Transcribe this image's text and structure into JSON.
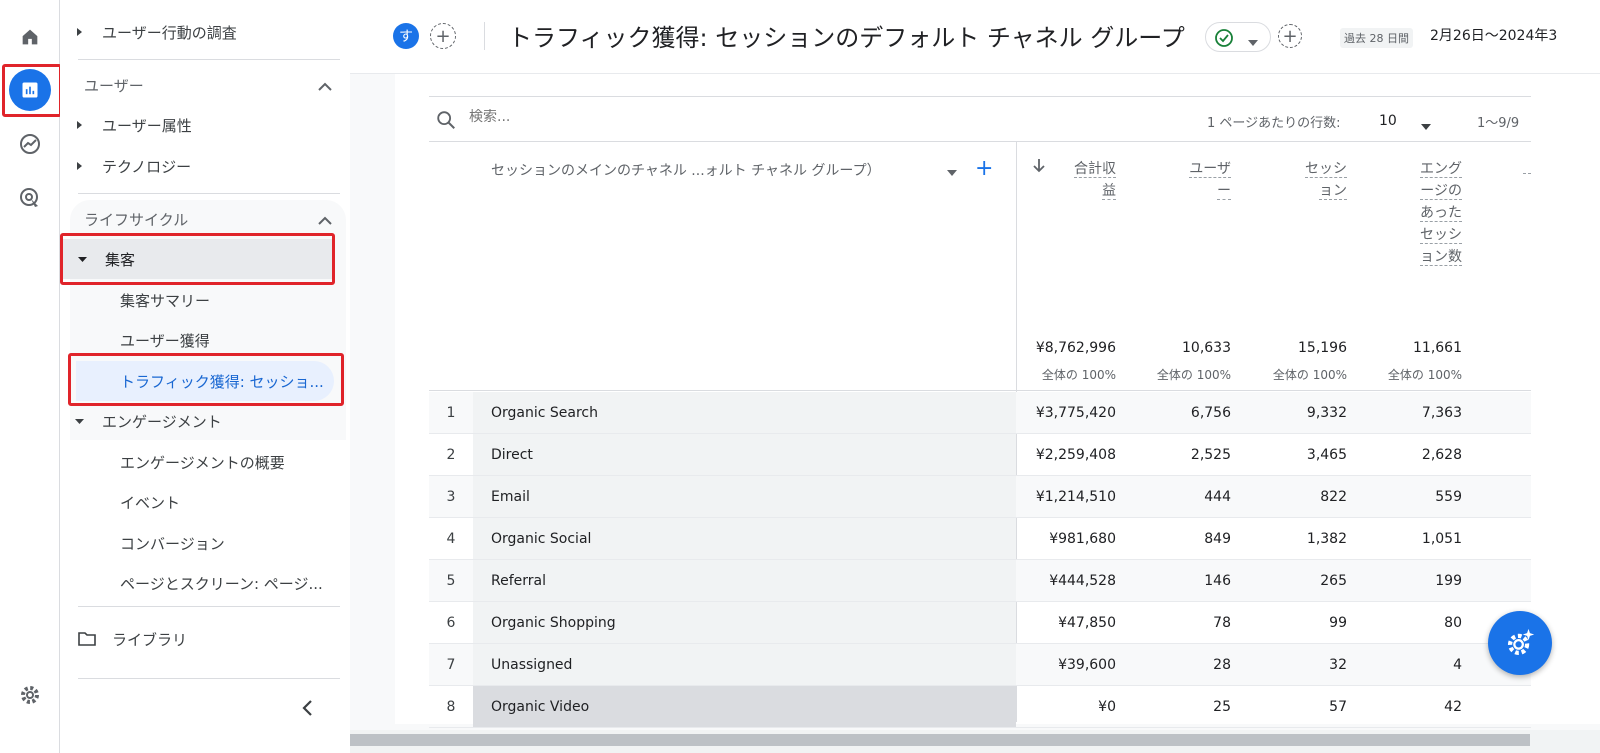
{
  "header": {
    "avatar_letter": "す",
    "title": "トラフィック獲得: セッションのデフォルト チャネル グループ",
    "date_prefix": "過去 28 日間",
    "date_range": "2月26日～2024年3"
  },
  "rail": {
    "items": [
      {
        "icon": "home-icon"
      },
      {
        "icon": "reports-icon",
        "active": true
      },
      {
        "icon": "explore-icon"
      },
      {
        "icon": "advertising-icon"
      },
      {
        "icon": "settings-icon"
      }
    ]
  },
  "nav": {
    "behavior_label": "ユーザー行動の調査",
    "user_section": "ユーザー",
    "user_attributes": "ユーザー属性",
    "technology": "テクノロジー",
    "lifecycle_section": "ライフサイクル",
    "acquisition": "集客",
    "acquisition_overview": "集客サマリー",
    "user_acquisition": "ユーザー獲得",
    "traffic_acquisition": "トラフィック獲得: セッショ...",
    "engagement": "エンゲージメント",
    "engagement_overview": "エンゲージメントの概要",
    "events": "イベント",
    "conversions": "コンバージョン",
    "pages_screens": "ページとスクリーン: ページ...",
    "library": "ライブラリ"
  },
  "toolbar": {
    "search_placeholder": "検索...",
    "rows_per_page_label": "1 ページあたりの行数:",
    "rows_per_page_value": "10",
    "pager_text": "1～9/9"
  },
  "table": {
    "dimension_header": "セッションのメインのチャネル ...ォルト チャネル グループ）",
    "metric_headers": [
      [
        "合計収",
        "益"
      ],
      [
        "ユーザ",
        "ー"
      ],
      [
        "セッシ",
        "ョン"
      ],
      [
        "エング",
        "ージの",
        "あった",
        "セッシ",
        "ョン数"
      ]
    ],
    "totals": [
      "¥8,762,996",
      "10,633",
      "15,196",
      "11,661"
    ],
    "totals_sub": [
      "全体の 100%",
      "全体の 100%",
      "全体の 100%",
      "全体の 100%"
    ],
    "rows": [
      {
        "idx": "1",
        "channel": "Organic Search",
        "revenue": "¥3,775,420",
        "users": "6,756",
        "sessions": "9,332",
        "engaged": "7,363"
      },
      {
        "idx": "2",
        "channel": "Direct",
        "revenue": "¥2,259,408",
        "users": "2,525",
        "sessions": "3,465",
        "engaged": "2,628"
      },
      {
        "idx": "3",
        "channel": "Email",
        "revenue": "¥1,214,510",
        "users": "444",
        "sessions": "822",
        "engaged": "559"
      },
      {
        "idx": "4",
        "channel": "Organic Social",
        "revenue": "¥981,680",
        "users": "849",
        "sessions": "1,382",
        "engaged": "1,051"
      },
      {
        "idx": "5",
        "channel": "Referral",
        "revenue": "¥444,528",
        "users": "146",
        "sessions": "265",
        "engaged": "199"
      },
      {
        "idx": "6",
        "channel": "Organic Shopping",
        "revenue": "¥47,850",
        "users": "78",
        "sessions": "99",
        "engaged": "80"
      },
      {
        "idx": "7",
        "channel": "Unassigned",
        "revenue": "¥39,600",
        "users": "28",
        "sessions": "32",
        "engaged": "4"
      },
      {
        "idx": "8",
        "channel": "Organic Video",
        "revenue": "¥0",
        "users": "25",
        "sessions": "57",
        "engaged": "42"
      }
    ]
  },
  "colors": {
    "accent": "#1a73e8",
    "highlight_box": "#e0242a",
    "selected_bg": "#e8f0fe"
  }
}
